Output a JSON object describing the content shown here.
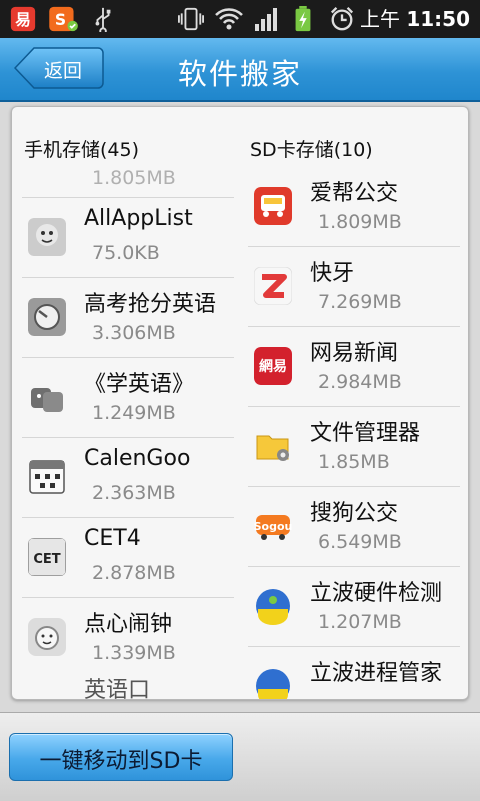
{
  "statusbar": {
    "time_prefix": "上午",
    "time": "11:50",
    "icons": [
      "yi-app-icon",
      "sogou-input-icon",
      "usb-icon",
      "vibrate-icon",
      "wifi-icon",
      "signal-icon",
      "battery-charging-icon",
      "alarm-icon"
    ]
  },
  "titlebar": {
    "back_label": "返回",
    "title": "软件搬家"
  },
  "phone_storage": {
    "header": "手机存储(45)",
    "partial_top": "1.805MB",
    "items": [
      {
        "name": "AllAppList",
        "size": "75.0KB",
        "icon": "allapplist-icon"
      },
      {
        "name": "高考抢分英语",
        "size": "3.306MB",
        "icon": "gaokao-english-icon"
      },
      {
        "name": "《学英语》",
        "size": "1.249MB",
        "icon": "learn-english-icon"
      },
      {
        "name": "CalenGoo",
        "size": "2.363MB",
        "icon": "calengoo-icon"
      },
      {
        "name": "CET4",
        "size": "2.878MB",
        "icon": "cet4-icon"
      },
      {
        "name": "点心闹钟",
        "size": "1.339MB",
        "icon": "dianxin-clock-icon"
      }
    ],
    "partial_bottom": "英语口"
  },
  "sd_storage": {
    "header": "SD卡存储(10)",
    "items": [
      {
        "name": "爱帮公交",
        "size": "1.809MB",
        "icon": "aibang-bus-icon"
      },
      {
        "name": "快牙",
        "size": "7.269MB",
        "icon": "kuaiya-icon"
      },
      {
        "name": "网易新闻",
        "size": "2.984MB",
        "icon": "netease-news-icon"
      },
      {
        "name": "文件管理器",
        "size": "1.85MB",
        "icon": "file-manager-icon"
      },
      {
        "name": "搜狗公交",
        "size": "6.549MB",
        "icon": "sogou-bus-icon"
      },
      {
        "name": "立波硬件检测",
        "size": "1.207MB",
        "icon": "libo-hardware-icon"
      }
    ],
    "partial_bottom": "立波进程管家"
  },
  "bottom": {
    "move_label": "一键移动到SD卡"
  }
}
